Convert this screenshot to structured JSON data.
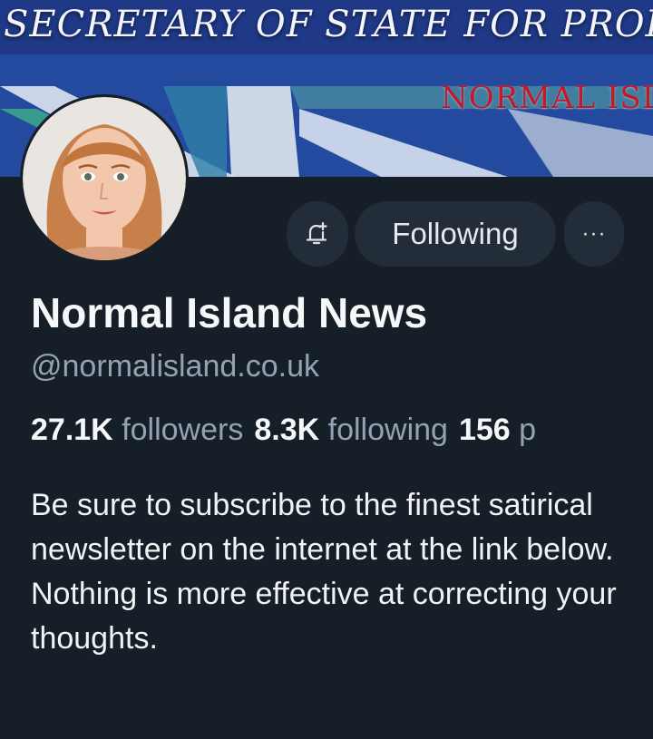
{
  "banner": {
    "title": "SECRETARY OF STATE FOR PROPAGAI",
    "subtitle": "NORMAL ISL"
  },
  "profile": {
    "display_name": "Normal Island News",
    "handle": "@normalisland.co.uk",
    "bio": "Be sure to subscribe to the finest satirical newsletter on the internet at the link below. Nothing is more effective at correcting your thoughts."
  },
  "actions": {
    "notify_icon": "bell-plus-icon",
    "follow_label": "Following",
    "more_label": "···"
  },
  "stats": {
    "followers_count": "27.1K",
    "followers_label": "followers",
    "following_count": "8.3K",
    "following_label": "following",
    "posts_count": "156",
    "posts_label": "p"
  },
  "colors": {
    "background": "#161e27",
    "button_bg": "#232d3a",
    "muted_text": "#93a3b4",
    "banner_red": "#c4182a"
  }
}
